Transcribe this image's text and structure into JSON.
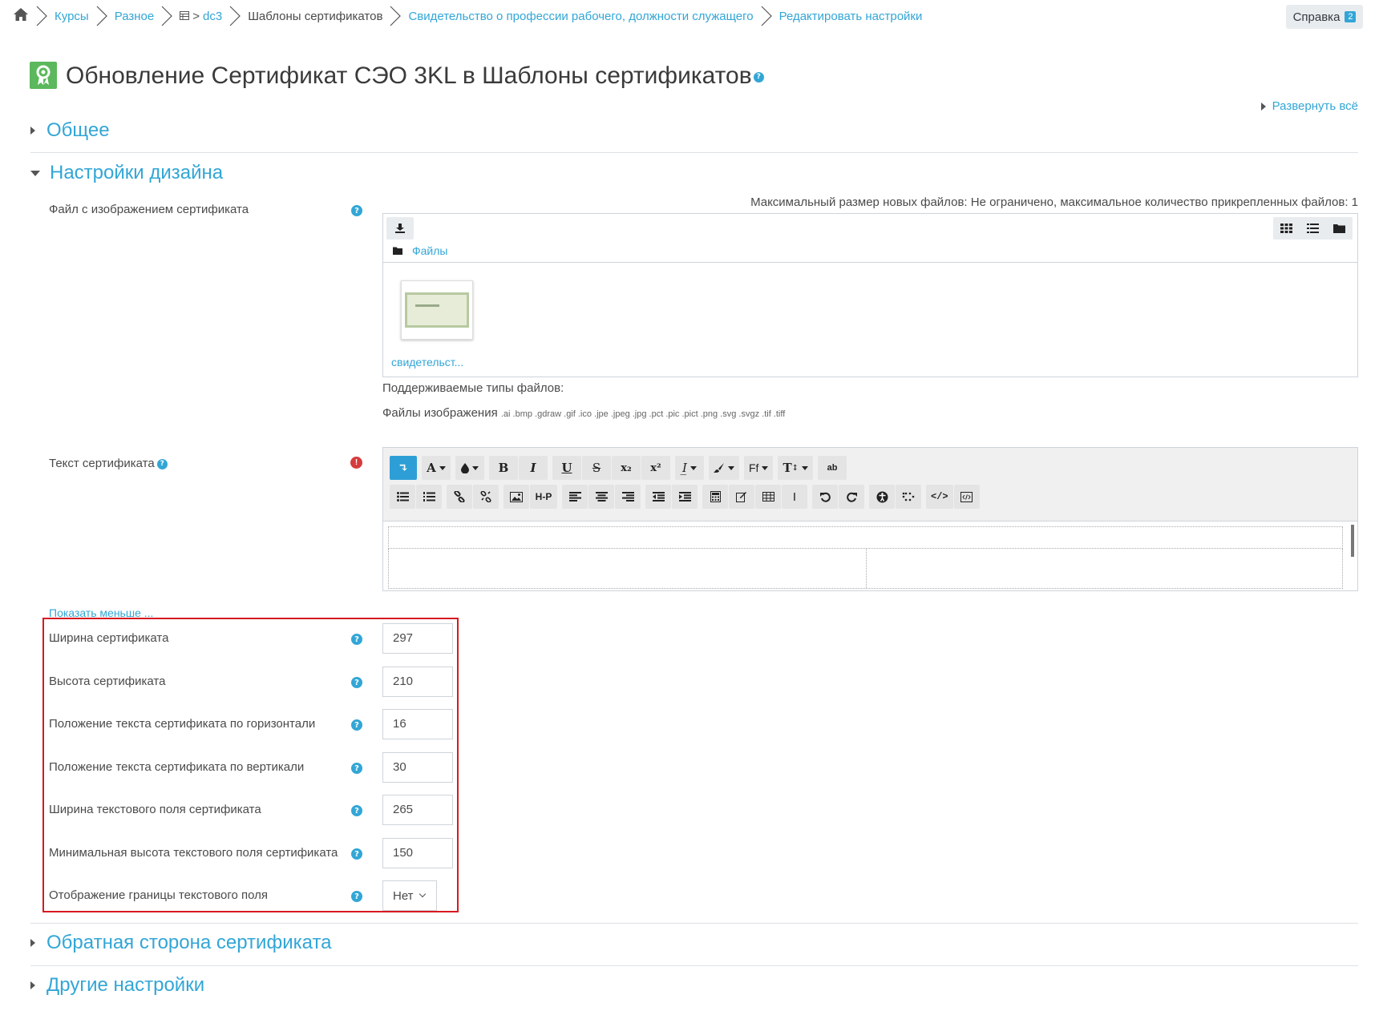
{
  "breadcrumb": {
    "items": [
      "Курсы",
      "Разное",
      "dc3",
      "Шаблоны сертификатов",
      "Свидетельство о профессии рабочего, должности служащего",
      "Редактировать настройки"
    ]
  },
  "help_button": {
    "label": "Справка",
    "badge": "2"
  },
  "page_title": "Обновление Сертификат СЭО 3KL в Шаблоны сертификатов",
  "expand_all": "Развернуть всё",
  "sections": {
    "general": "Общее",
    "design": "Настройки дизайна",
    "back": "Обратная сторона сертификата",
    "other": "Другие настройки"
  },
  "file_field": {
    "label": "Файл с изображением сертификата",
    "max_info": "Максимальный размер новых файлов: Не ограничено, максимальное количество прикрепленных файлов: 1",
    "path_label": "Файлы",
    "file_name": "свидетельст...",
    "supported_label": "Поддерживаемые типы файлов:",
    "image_types_label": "Файлы изображения",
    "image_types_ext": ".ai .bmp .gdraw .gif .ico .jpe .jpeg .jpg .pct .pic .pict .png .svg .svgz .tif .tiff"
  },
  "text_field": {
    "label": "Текст сертификата"
  },
  "editor": {
    "row1": [
      {
        "name": "toggle-toolbar",
        "glyph": "↴"
      },
      {
        "name": "font-color",
        "glyph": "A"
      },
      {
        "name": "background-color",
        "glyph": "💧"
      },
      {
        "name": "bold",
        "glyph": "B"
      },
      {
        "name": "italic",
        "glyph": "I"
      },
      {
        "name": "underline",
        "glyph": "U"
      },
      {
        "name": "strikethrough",
        "glyph": "S"
      },
      {
        "name": "subscript",
        "glyph": "x₂"
      },
      {
        "name": "superscript",
        "glyph": "x²"
      },
      {
        "name": "clear-format",
        "glyph": "I̲"
      },
      {
        "name": "brush",
        "glyph": "🖌"
      },
      {
        "name": "font-family",
        "glyph": "Ff"
      },
      {
        "name": "font-size",
        "glyph": "T"
      },
      {
        "name": "spellcheck",
        "glyph": "ab"
      }
    ],
    "row2": [
      "bulleted-list",
      "numbered-list",
      "link",
      "unlink",
      "image",
      "h5p",
      "align-left",
      "align-center",
      "align-right",
      "outdent",
      "indent",
      "equation",
      "edit",
      "table",
      "cursor",
      "undo",
      "redo",
      "accessibility",
      "braille",
      "html",
      "code"
    ]
  },
  "show_less": "Показать меньше ...",
  "fields": [
    {
      "label": "Ширина сертификата",
      "value": "297"
    },
    {
      "label": "Высота сертификата",
      "value": "210"
    },
    {
      "label": "Положение текста сертификата по горизонтали",
      "value": "16"
    },
    {
      "label": "Положение текста сертификата по вертикали",
      "value": "30"
    },
    {
      "label": "Ширина текстового поля сертификата",
      "value": "265"
    },
    {
      "label": "Минимальная высота текстового поля сертификата",
      "value": "150"
    }
  ],
  "border_field": {
    "label": "Отображение границы текстового поля",
    "value": "Нет"
  },
  "colors": {
    "accent": "#32a6d6",
    "highlight_border": "#d71920",
    "title_icon": "#5cb85c",
    "error": "#d63c3c"
  }
}
